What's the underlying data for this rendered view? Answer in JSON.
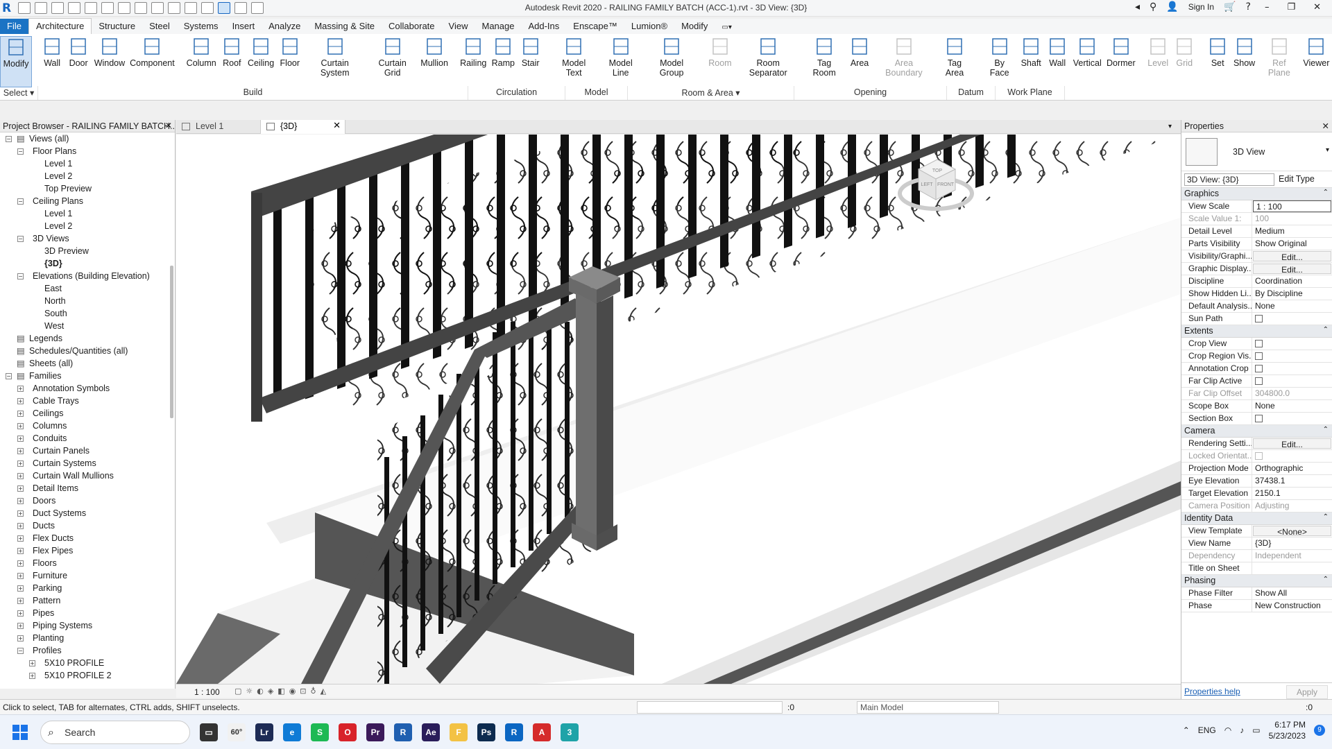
{
  "app": {
    "title": "Autodesk Revit 2020 - RAILING FAMILY BATCH (ACC-1).rvt - 3D View: {3D}",
    "sign_in": "Sign In"
  },
  "ribbon_tabs": [
    "File",
    "Architecture",
    "Structure",
    "Steel",
    "Systems",
    "Insert",
    "Analyze",
    "Massing & Site",
    "Collaborate",
    "View",
    "Manage",
    "Add-Ins",
    "Enscape™",
    "Lumion®",
    "Modify"
  ],
  "ribbon_buttons": [
    {
      "label": "Modify",
      "disabled": false
    },
    {
      "label": "Wall",
      "disabled": false
    },
    {
      "label": "Door",
      "disabled": false
    },
    {
      "label": "Window",
      "disabled": false
    },
    {
      "label": "Component",
      "disabled": false
    },
    {
      "label": "Column",
      "disabled": false
    },
    {
      "label": "Roof",
      "disabled": false
    },
    {
      "label": "Ceiling",
      "disabled": false
    },
    {
      "label": "Floor",
      "disabled": false
    },
    {
      "label": "Curtain System",
      "disabled": false
    },
    {
      "label": "Curtain Grid",
      "disabled": false
    },
    {
      "label": "Mullion",
      "disabled": false
    },
    {
      "label": "Railing",
      "disabled": false
    },
    {
      "label": "Ramp",
      "disabled": false
    },
    {
      "label": "Stair",
      "disabled": false
    },
    {
      "label": "Model Text",
      "disabled": false
    },
    {
      "label": "Model Line",
      "disabled": false
    },
    {
      "label": "Model Group",
      "disabled": false
    },
    {
      "label": "Room",
      "disabled": true
    },
    {
      "label": "Room Separator",
      "disabled": false
    },
    {
      "label": "Tag Room",
      "disabled": false
    },
    {
      "label": "Area",
      "disabled": false
    },
    {
      "label": "Area Boundary",
      "disabled": true
    },
    {
      "label": "Tag Area",
      "disabled": false
    },
    {
      "label": "By Face",
      "disabled": false
    },
    {
      "label": "Shaft",
      "disabled": false
    },
    {
      "label": "Wall",
      "disabled": false
    },
    {
      "label": "Vertical",
      "disabled": false
    },
    {
      "label": "Dormer",
      "disabled": false
    },
    {
      "label": "Level",
      "disabled": true
    },
    {
      "label": "Grid",
      "disabled": true
    },
    {
      "label": "Set",
      "disabled": false
    },
    {
      "label": "Show",
      "disabled": false
    },
    {
      "label": "Ref Plane",
      "disabled": true
    },
    {
      "label": "Viewer",
      "disabled": false
    }
  ],
  "ribbon_panels": [
    "Select ▾",
    "Build",
    "Circulation",
    "Model",
    "Room & Area ▾",
    "Opening",
    "Datum",
    "Work Plane"
  ],
  "project_browser": {
    "title": "Project Browser - RAILING FAMILY BATCH...",
    "items": [
      {
        "label": "Views (all)",
        "level": 0,
        "toggle": "-"
      },
      {
        "label": "Floor Plans",
        "level": 1,
        "toggle": "-"
      },
      {
        "label": "Level 1",
        "level": 2,
        "toggle": ""
      },
      {
        "label": "Level 2",
        "level": 2,
        "toggle": ""
      },
      {
        "label": "Top Preview",
        "level": 2,
        "toggle": ""
      },
      {
        "label": "Ceiling Plans",
        "level": 1,
        "toggle": "-"
      },
      {
        "label": "Level 1",
        "level": 2,
        "toggle": ""
      },
      {
        "label": "Level 2",
        "level": 2,
        "toggle": ""
      },
      {
        "label": "3D Views",
        "level": 1,
        "toggle": "-"
      },
      {
        "label": "3D Preview",
        "level": 2,
        "toggle": ""
      },
      {
        "label": "{3D}",
        "level": 2,
        "toggle": "",
        "bold": true
      },
      {
        "label": "Elevations (Building Elevation)",
        "level": 1,
        "toggle": "-"
      },
      {
        "label": "East",
        "level": 2,
        "toggle": ""
      },
      {
        "label": "North",
        "level": 2,
        "toggle": ""
      },
      {
        "label": "South",
        "level": 2,
        "toggle": ""
      },
      {
        "label": "West",
        "level": 2,
        "toggle": ""
      },
      {
        "label": "Legends",
        "level": 0,
        "toggle": ""
      },
      {
        "label": "Schedules/Quantities (all)",
        "level": 0,
        "toggle": ""
      },
      {
        "label": "Sheets (all)",
        "level": 0,
        "toggle": ""
      },
      {
        "label": "Families",
        "level": 0,
        "toggle": "-"
      },
      {
        "label": "Annotation Symbols",
        "level": 1,
        "toggle": "+"
      },
      {
        "label": "Cable Trays",
        "level": 1,
        "toggle": "+"
      },
      {
        "label": "Ceilings",
        "level": 1,
        "toggle": "+"
      },
      {
        "label": "Columns",
        "level": 1,
        "toggle": "+"
      },
      {
        "label": "Conduits",
        "level": 1,
        "toggle": "+"
      },
      {
        "label": "Curtain Panels",
        "level": 1,
        "toggle": "+"
      },
      {
        "label": "Curtain Systems",
        "level": 1,
        "toggle": "+"
      },
      {
        "label": "Curtain Wall Mullions",
        "level": 1,
        "toggle": "+"
      },
      {
        "label": "Detail Items",
        "level": 1,
        "toggle": "+"
      },
      {
        "label": "Doors",
        "level": 1,
        "toggle": "+"
      },
      {
        "label": "Duct Systems",
        "level": 1,
        "toggle": "+"
      },
      {
        "label": "Ducts",
        "level": 1,
        "toggle": "+"
      },
      {
        "label": "Flex Ducts",
        "level": 1,
        "toggle": "+"
      },
      {
        "label": "Flex Pipes",
        "level": 1,
        "toggle": "+"
      },
      {
        "label": "Floors",
        "level": 1,
        "toggle": "+"
      },
      {
        "label": "Furniture",
        "level": 1,
        "toggle": "+"
      },
      {
        "label": "Parking",
        "level": 1,
        "toggle": "+"
      },
      {
        "label": "Pattern",
        "level": 1,
        "toggle": "+"
      },
      {
        "label": "Pipes",
        "level": 1,
        "toggle": "+"
      },
      {
        "label": "Piping Systems",
        "level": 1,
        "toggle": "+"
      },
      {
        "label": "Planting",
        "level": 1,
        "toggle": "+"
      },
      {
        "label": "Profiles",
        "level": 1,
        "toggle": "-"
      },
      {
        "label": "5X10 PROFILE",
        "level": 2,
        "toggle": "+"
      },
      {
        "label": "5X10 PROFILE 2",
        "level": 2,
        "toggle": "+"
      }
    ]
  },
  "view_tabs": [
    {
      "label": "Level 1",
      "active": false
    },
    {
      "label": "{3D}",
      "active": true
    }
  ],
  "view_bar": {
    "scale": "1 : 100"
  },
  "viewcube": {
    "top": "TOP",
    "front": "FRONT",
    "left": "LEFT"
  },
  "properties": {
    "title": "Properties",
    "type_name": "3D View",
    "instance_selector": "3D View: {3D}",
    "edit_type": "Edit Type",
    "groups": [
      {
        "name": "Graphics",
        "rows": [
          {
            "name": "View Scale",
            "value": "1 : 100",
            "kind": "boxed"
          },
          {
            "name": "Scale Value    1:",
            "value": "100",
            "kind": "dim"
          },
          {
            "name": "Detail Level",
            "value": "Medium"
          },
          {
            "name": "Parts Visibility",
            "value": "Show Original"
          },
          {
            "name": "Visibility/Graphi...",
            "value": "Edit...",
            "kind": "btn"
          },
          {
            "name": "Graphic Display...",
            "value": "Edit...",
            "kind": "btn"
          },
          {
            "name": "Discipline",
            "value": "Coordination"
          },
          {
            "name": "Show Hidden Li...",
            "value": "By Discipline"
          },
          {
            "name": "Default Analysis...",
            "value": "None"
          },
          {
            "name": "Sun Path",
            "value": "",
            "kind": "chk"
          }
        ]
      },
      {
        "name": "Extents",
        "rows": [
          {
            "name": "Crop View",
            "value": "",
            "kind": "chk"
          },
          {
            "name": "Crop Region Vis...",
            "value": "",
            "kind": "chk"
          },
          {
            "name": "Annotation Crop",
            "value": "",
            "kind": "chk"
          },
          {
            "name": "Far Clip Active",
            "value": "",
            "kind": "chk"
          },
          {
            "name": "Far Clip Offset",
            "value": "304800.0",
            "kind": "dim"
          },
          {
            "name": "Scope Box",
            "value": "None"
          },
          {
            "name": "Section Box",
            "value": "",
            "kind": "chk"
          }
        ]
      },
      {
        "name": "Camera",
        "rows": [
          {
            "name": "Rendering Setti...",
            "value": "Edit...",
            "kind": "btn"
          },
          {
            "name": "Locked Orientat...",
            "value": "",
            "kind": "chkdim"
          },
          {
            "name": "Projection Mode",
            "value": "Orthographic"
          },
          {
            "name": "Eye Elevation",
            "value": "37438.1"
          },
          {
            "name": "Target Elevation",
            "value": "2150.1"
          },
          {
            "name": "Camera Position",
            "value": "Adjusting",
            "kind": "dim"
          }
        ]
      },
      {
        "name": "Identity Data",
        "rows": [
          {
            "name": "View Template",
            "value": "<None>",
            "kind": "btn"
          },
          {
            "name": "View Name",
            "value": "{3D}"
          },
          {
            "name": "Dependency",
            "value": "Independent",
            "kind": "dim"
          },
          {
            "name": "Title on Sheet",
            "value": ""
          }
        ]
      },
      {
        "name": "Phasing",
        "rows": [
          {
            "name": "Phase Filter",
            "value": "Show All"
          },
          {
            "name": "Phase",
            "value": "New Construction"
          }
        ]
      }
    ],
    "help_link": "Properties help",
    "apply": "Apply"
  },
  "status": {
    "message": "Click to select, TAB for alternates, CTRL adds, SHIFT unselects.",
    "zero": ":0",
    "model": "Main Model",
    "right_zero": ":0"
  },
  "taskbar": {
    "search": "Search",
    "weather": "60°",
    "lang": "ENG",
    "time": "6:17 PM",
    "date": "5/23/2023",
    "badge": "9",
    "apps": [
      {
        "name": "Lr",
        "color": "#1d2b55"
      },
      {
        "name": "e",
        "color": "#0f7bd6"
      },
      {
        "name": "S",
        "color": "#1db954"
      },
      {
        "name": "O",
        "color": "#d8232a"
      },
      {
        "name": "Pr",
        "color": "#3b1a5a"
      },
      {
        "name": "R",
        "color": "#1f5fb0"
      },
      {
        "name": "Ae",
        "color": "#2a1d5a"
      },
      {
        "name": "F",
        "color": "#f3c244"
      },
      {
        "name": "Ps",
        "color": "#0d2b4f"
      },
      {
        "name": "R",
        "color": "#0b66c2"
      },
      {
        "name": "A",
        "color": "#d52b2b"
      },
      {
        "name": "3",
        "color": "#1fa3a8"
      }
    ]
  }
}
